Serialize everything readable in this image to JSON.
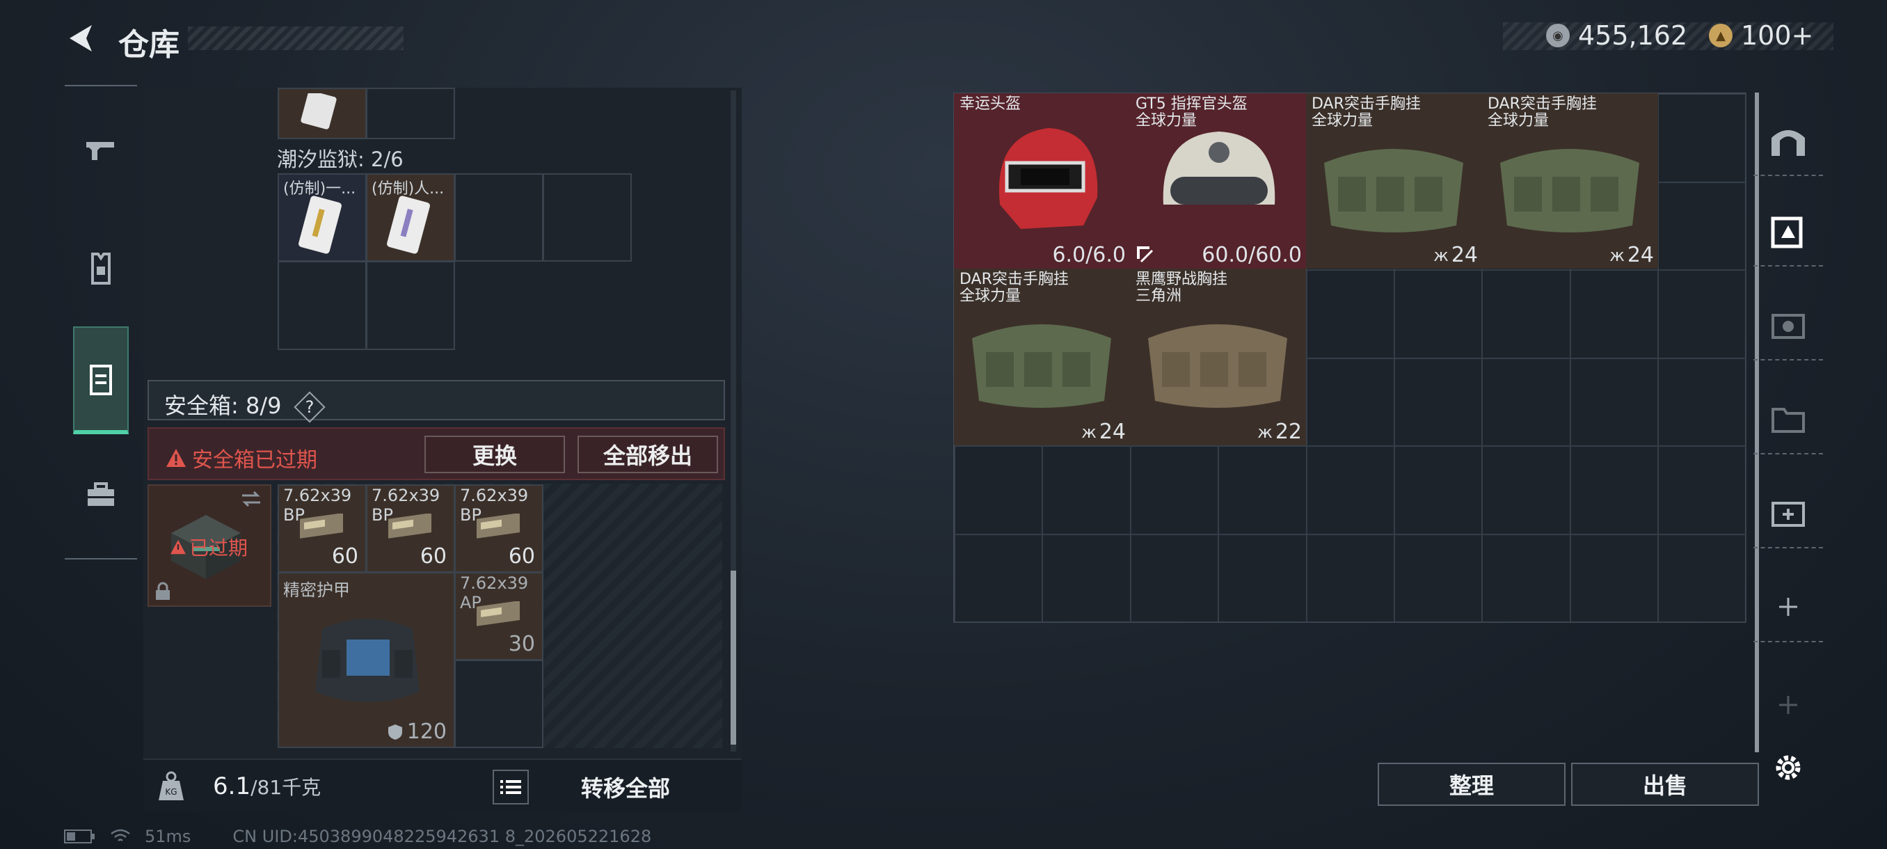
{
  "header": {
    "title": "仓库",
    "currency1": "455,162",
    "currency2": "100+"
  },
  "left_tabs": [
    "gun-tab",
    "armor-tab",
    "container-tab",
    "toolbox-tab"
  ],
  "tide_prison": {
    "label": "潮汐监狱: 2/6",
    "items": [
      "(仿制)一...",
      "(仿制)人..."
    ]
  },
  "safebox": {
    "label": "安全箱: 8/9",
    "help": "?",
    "warning": "安全箱已过期",
    "replace": "更换",
    "remove_all": "全部移出",
    "expired": "已过期"
  },
  "safebox_items": [
    {
      "name": "7.62x39 BP",
      "count": "60"
    },
    {
      "name": "7.62x39 BP",
      "count": "60"
    },
    {
      "name": "7.62x39 BP",
      "count": "60"
    },
    {
      "name": "精密护甲",
      "durability": "120"
    },
    {
      "name": "7.62x39 AP",
      "count": "30"
    }
  ],
  "footer": {
    "weight": "6.1",
    "weight_max": "/81千克",
    "transfer_all": "转移全部"
  },
  "storage_items": [
    {
      "name": "幸运头盔",
      "sub": "",
      "value": "6.0/6.0"
    },
    {
      "name": "GT5 指挥官头盔",
      "sub": "全球力量",
      "value": "60.0/60.0"
    },
    {
      "name": "DAR突击手胸挂",
      "sub": "全球力量",
      "value": "24"
    },
    {
      "name": "DAR突击手胸挂",
      "sub": "全球力量",
      "value": "24"
    },
    {
      "name": "DAR突击手胸挂",
      "sub": "全球力量",
      "value": "24"
    },
    {
      "name": "黑鹰野战胸挂",
      "sub": "三角洲",
      "value": "22"
    }
  ],
  "actions": {
    "sort": "整理",
    "sell": "出售"
  },
  "status": {
    "ping": "51ms",
    "uid": "CN UID:4503899048225942631 8_202605221628"
  }
}
